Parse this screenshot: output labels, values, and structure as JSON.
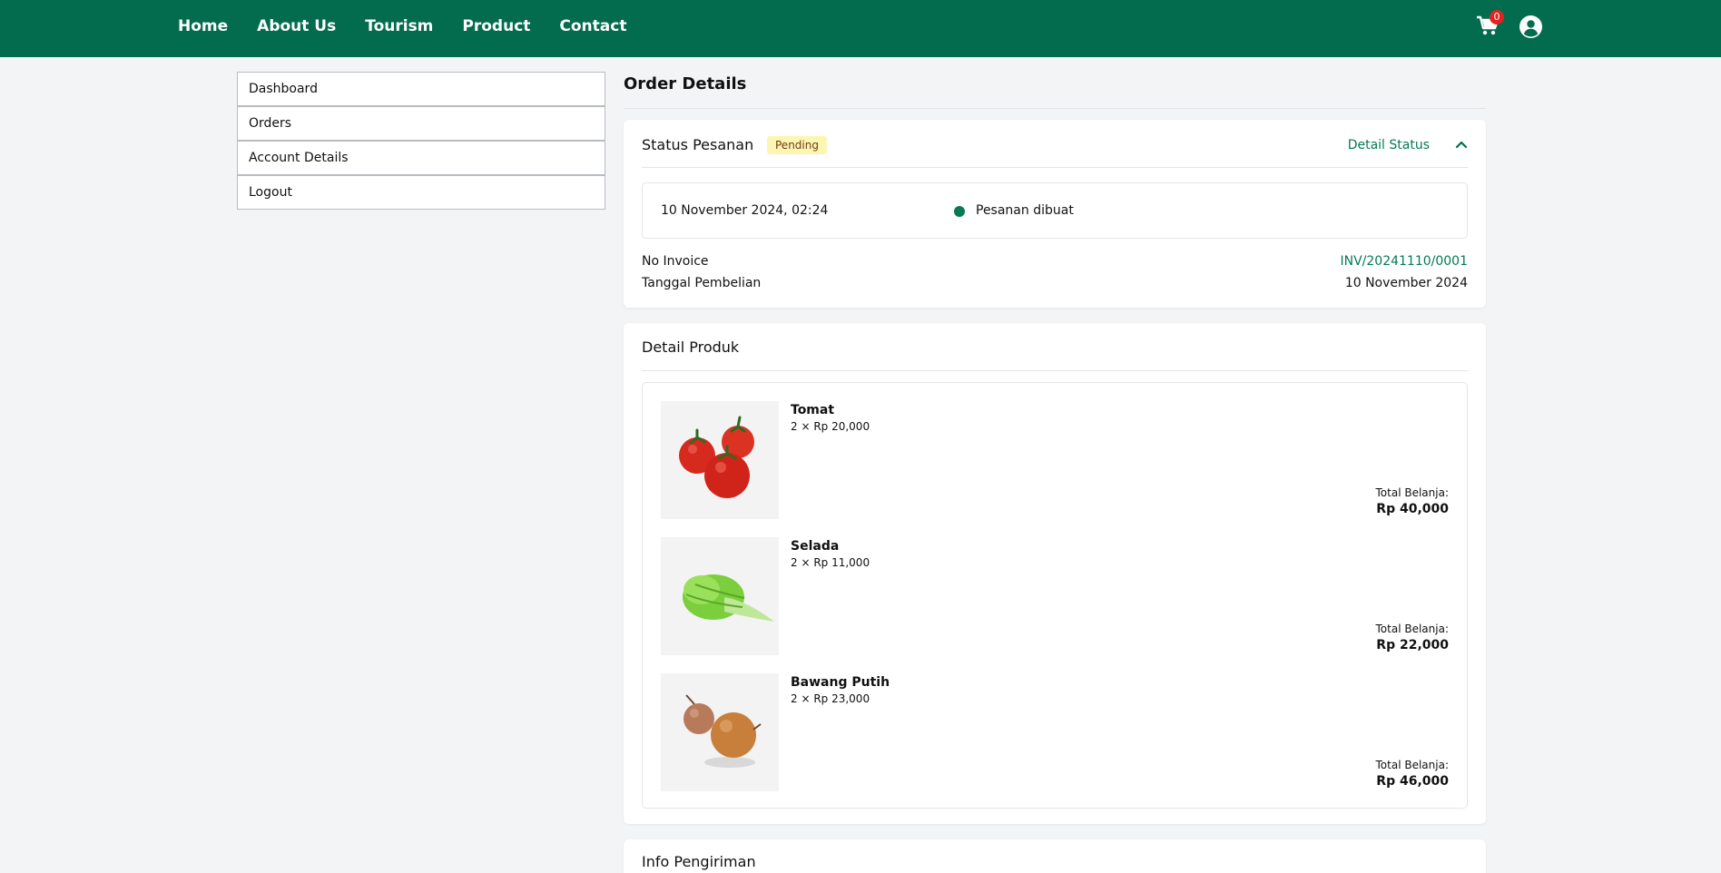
{
  "nav": {
    "links": [
      "Home",
      "About Us",
      "Tourism",
      "Product",
      "Contact"
    ],
    "cart_count": "0",
    "cart_icon": "shopping-cart-icon",
    "user_icon": "user-circle-icon"
  },
  "sidebar": {
    "items": [
      "Dashboard",
      "Orders",
      "Account Details",
      "Logout"
    ]
  },
  "page": {
    "title": "Order Details"
  },
  "status": {
    "title": "Status Pesanan",
    "badge": "Pending",
    "toggle_label": "Detail Status",
    "timeline": {
      "date": "10 November 2024, 02:24",
      "text": "Pesanan dibuat"
    },
    "invoice_label": "No Invoice",
    "invoice_value": "INV/20241110/0001",
    "purchase_date_label": "Tanggal Pembelian",
    "purchase_date_value": "10 November 2024"
  },
  "products": {
    "title": "Detail Produk",
    "total_label": "Total Belanja:",
    "items": [
      {
        "name": "Tomat",
        "qty": "2 × Rp 20,000",
        "total": "Rp 40,000"
      },
      {
        "name": "Selada",
        "qty": "2 × Rp 11,000",
        "total": "Rp 22,000"
      },
      {
        "name": "Bawang Putih",
        "qty": "2 × Rp 23,000",
        "total": "Rp 46,000"
      }
    ]
  },
  "shipping": {
    "title": "Info Pengiriman"
  },
  "colors": {
    "brand": "#046c4e",
    "accent": "#057a55",
    "badge_bg": "#fdf6b2",
    "cart_badge": "#e02424"
  }
}
